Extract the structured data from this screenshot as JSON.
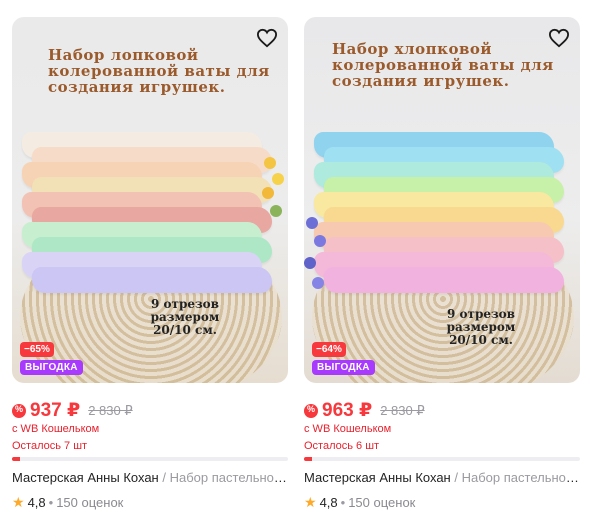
{
  "products": [
    {
      "photo_title": "Набор лопковой колерованной ваты для создания игрушек.",
      "photo_note": "9 отрезов размером 20/10 см.",
      "discount": "−65%",
      "promo": "ВЫГОДКА",
      "price": "937 ₽",
      "old_price": "2 830 ₽",
      "wallet_note": "с WB Кошельком",
      "stock": "Осталось 7 шт",
      "stock_level": 0.03,
      "brand": "Мастерская Анны Кохан",
      "separator": "/",
      "name": "Набор пастельной ваты",
      "rating": "4,8",
      "reviews": "150 оценок",
      "layer_colors": [
        "#f4ece2",
        "#f6dcc8",
        "#f6d3b5",
        "#f2e0b6",
        "#f2c3b4",
        "#e8a7a0",
        "#c7efcf",
        "#aee7c6",
        "#d9d4f6",
        "#cbc6f3"
      ]
    },
    {
      "photo_title": "Набор хлопковой колерованной ваты для создания игрушек.",
      "photo_note": "9 отрезов размером 20/10 см.",
      "discount": "−64%",
      "promo": "ВЫГОДКА",
      "price": "963 ₽",
      "old_price": "2 830 ₽",
      "wallet_note": "с WB Кошельком",
      "stock": "Осталось 6 шт",
      "stock_level": 0.03,
      "brand": "Мастерская Анны Кохан",
      "separator": "/",
      "name": "Набор пастельной ваты",
      "rating": "4,8",
      "reviews": "150 оценок",
      "layer_colors": [
        "#8fd3ee",
        "#9fe0f2",
        "#aeeade",
        "#c7f0a8",
        "#f9e8a0",
        "#f8d98f",
        "#f7c9b0",
        "#f5c0c8",
        "#f4b8d8",
        "#f2b2e0"
      ]
    }
  ],
  "colors": {
    "accent_red": "#f7383c",
    "promo_purple": "#a73afd",
    "star": "#ffa928"
  },
  "icons": {
    "favorite": "heart-outline-icon",
    "wallet": "percent-badge-icon",
    "star": "star-icon"
  }
}
